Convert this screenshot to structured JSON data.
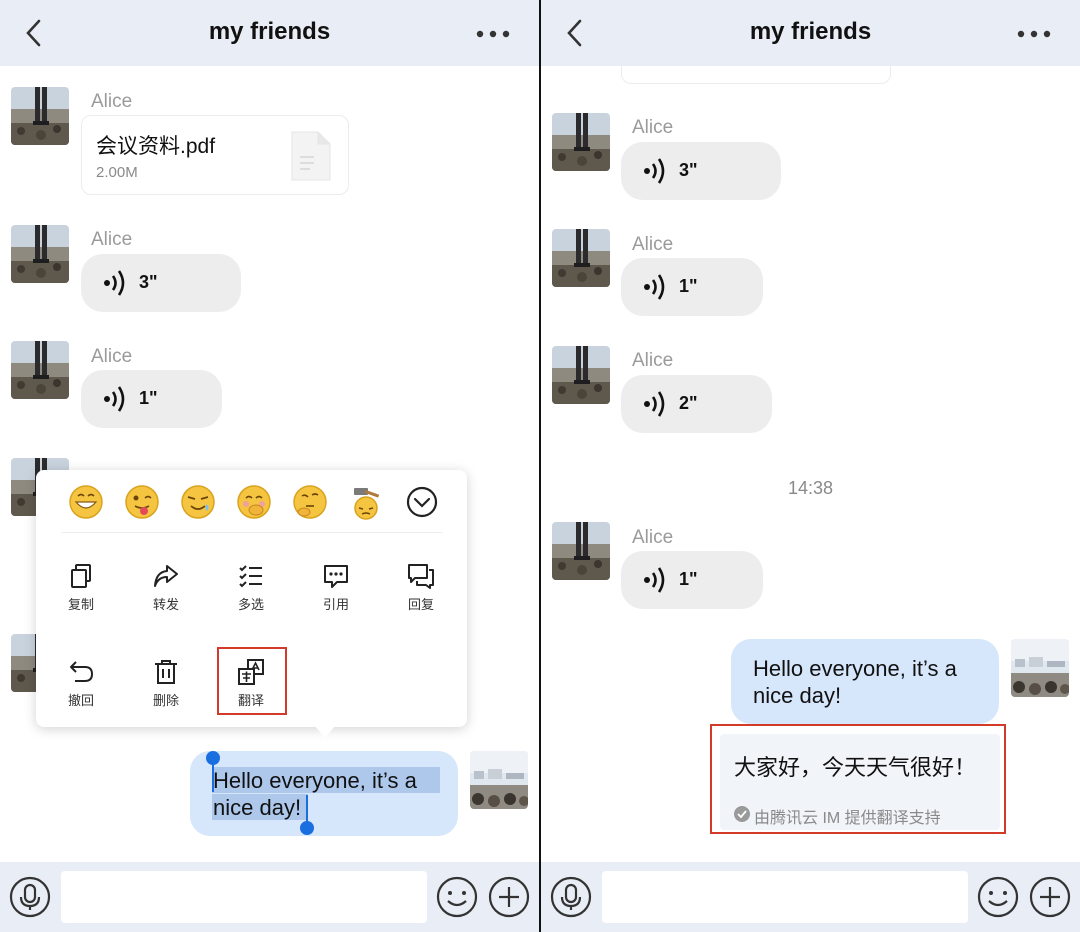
{
  "left": {
    "header": {
      "title": "my friends"
    },
    "messages": [
      {
        "sender": "Alice",
        "type": "file",
        "file_name": "会议资料.pdf",
        "file_size": "2.00M"
      },
      {
        "sender": "Alice",
        "type": "voice",
        "duration": "3\""
      },
      {
        "sender": "Alice",
        "type": "voice",
        "duration": "1\""
      }
    ],
    "outgoing": {
      "line1": "Hello everyone, it’s a",
      "line2": "nice day!"
    },
    "menu": {
      "actions": [
        {
          "label": "复制",
          "icon": "copy-icon"
        },
        {
          "label": "转发",
          "icon": "forward-icon"
        },
        {
          "label": "多选",
          "icon": "multi-select-icon"
        },
        {
          "label": "引用",
          "icon": "quote-icon"
        },
        {
          "label": "回复",
          "icon": "reply-icon"
        },
        {
          "label": "撤回",
          "icon": "recall-icon"
        },
        {
          "label": "删除",
          "icon": "delete-icon"
        },
        {
          "label": "翻译",
          "icon": "translate-icon"
        }
      ],
      "emoji": [
        "grin-emoji",
        "tongue-wink-emoji",
        "sweat-laugh-emoji",
        "shy-emoji",
        "thinking-emoji",
        "hammer-emoji",
        "expand-emoji-icon"
      ]
    }
  },
  "right": {
    "header": {
      "title": "my friends"
    },
    "messages": [
      {
        "sender": "Alice",
        "type": "voice",
        "duration": "3\""
      },
      {
        "sender": "Alice",
        "type": "voice",
        "duration": "1\""
      },
      {
        "sender": "Alice",
        "type": "voice",
        "duration": "2\""
      },
      {
        "sender": "Alice",
        "type": "voice",
        "duration": "1\""
      }
    ],
    "time_divider": "14:38",
    "outgoing": {
      "line1": "Hello everyone, it’s a",
      "line2": "nice day!"
    },
    "translation": {
      "text": "大家好，今天天气很好！",
      "note": "由腾讯云 IM 提供翻译支持"
    }
  },
  "colors": {
    "header_bg": "#e9eef6",
    "outgoing_bubble": "#d6e6fb",
    "incoming_bubble": "#ededed",
    "highlight": "#d23a2a",
    "selection": "#1a6fe0"
  }
}
